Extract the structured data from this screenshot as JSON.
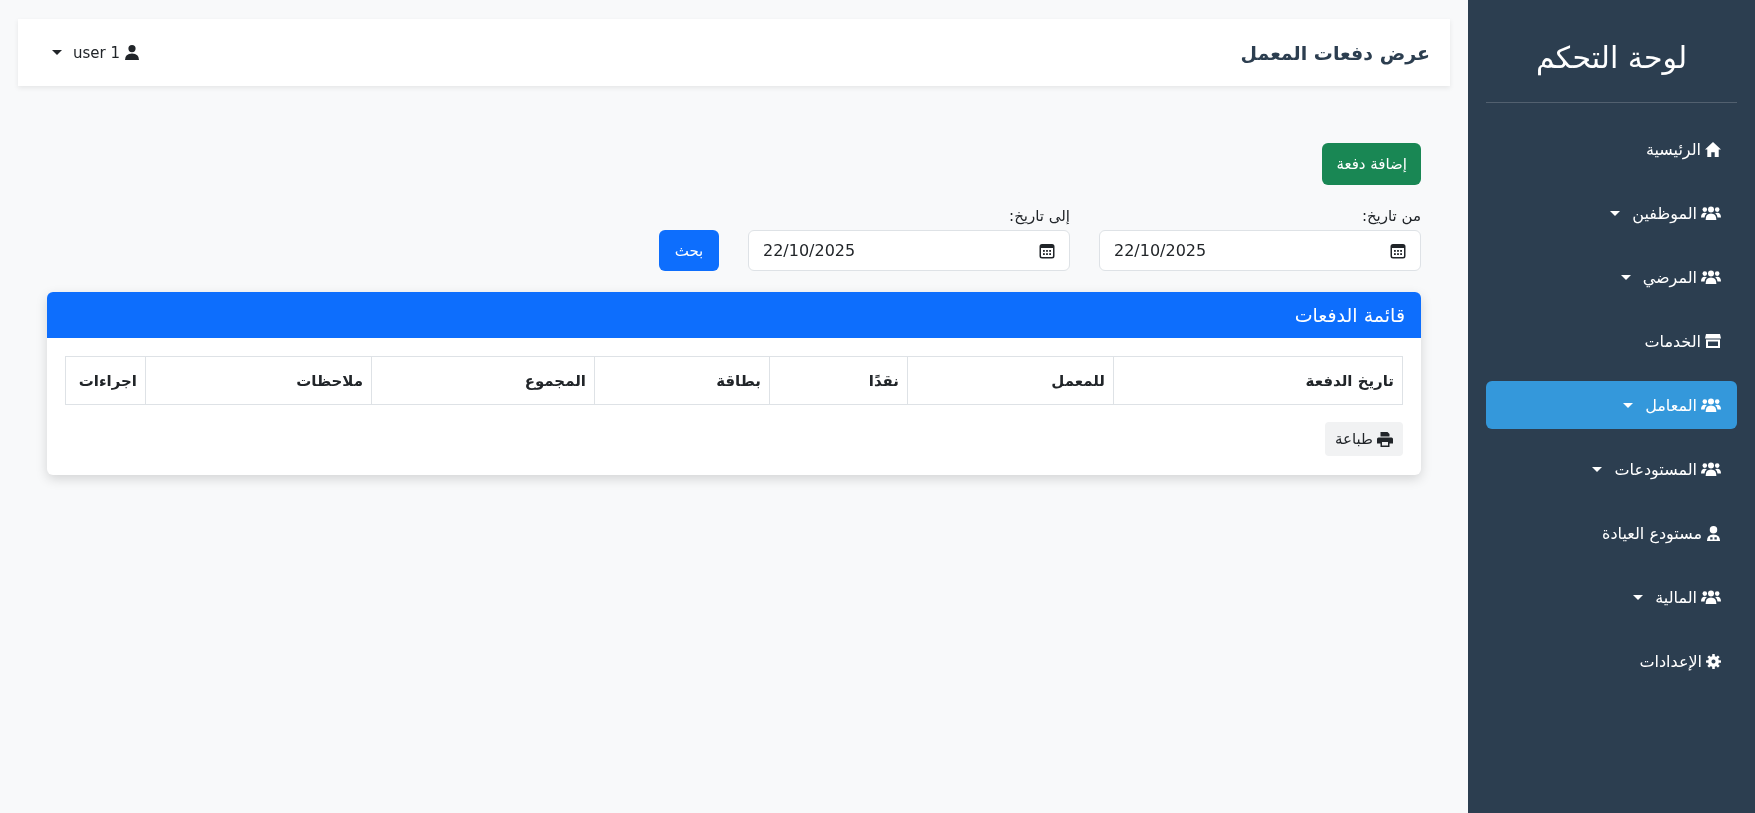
{
  "sidebar": {
    "title": "لوحة التحكم",
    "items": [
      {
        "label": "الرئيسية",
        "kind": "link",
        "selected": false
      },
      {
        "label": "الموظفين",
        "kind": "dropdown",
        "selected": false
      },
      {
        "label": "المرضي",
        "kind": "dropdown",
        "selected": false
      },
      {
        "label": "الخدمات",
        "kind": "link",
        "selected": false
      },
      {
        "label": "المعامل",
        "kind": "dropdown",
        "selected": true
      },
      {
        "label": "المستودعات",
        "kind": "dropdown",
        "selected": false
      },
      {
        "label": "مستودع العيادة",
        "kind": "link",
        "selected": false
      },
      {
        "label": "المالية",
        "kind": "dropdown",
        "selected": false
      },
      {
        "label": "الإعدادات",
        "kind": "link",
        "selected": false
      }
    ]
  },
  "header": {
    "title": "عرض دفعات المعمل",
    "user_menu": "user 1"
  },
  "add_button": "إضافة دفعة",
  "filters": [
    {
      "label": "من تاريخ:",
      "value": "22/10/2025"
    },
    {
      "label": "إلى تاريخ:",
      "value": "22/10/2025"
    }
  ],
  "search_button": "بحث",
  "payments_card": {
    "title": "قائمة الدفعات",
    "table": {
      "columns": [
        "تاريخ الدفعة",
        "للمعمل",
        "نقدًا",
        "بطاقة",
        "المجموع",
        "ملاحظات",
        "اجراءات"
      ]
    },
    "print_button": "طباعة"
  }
}
